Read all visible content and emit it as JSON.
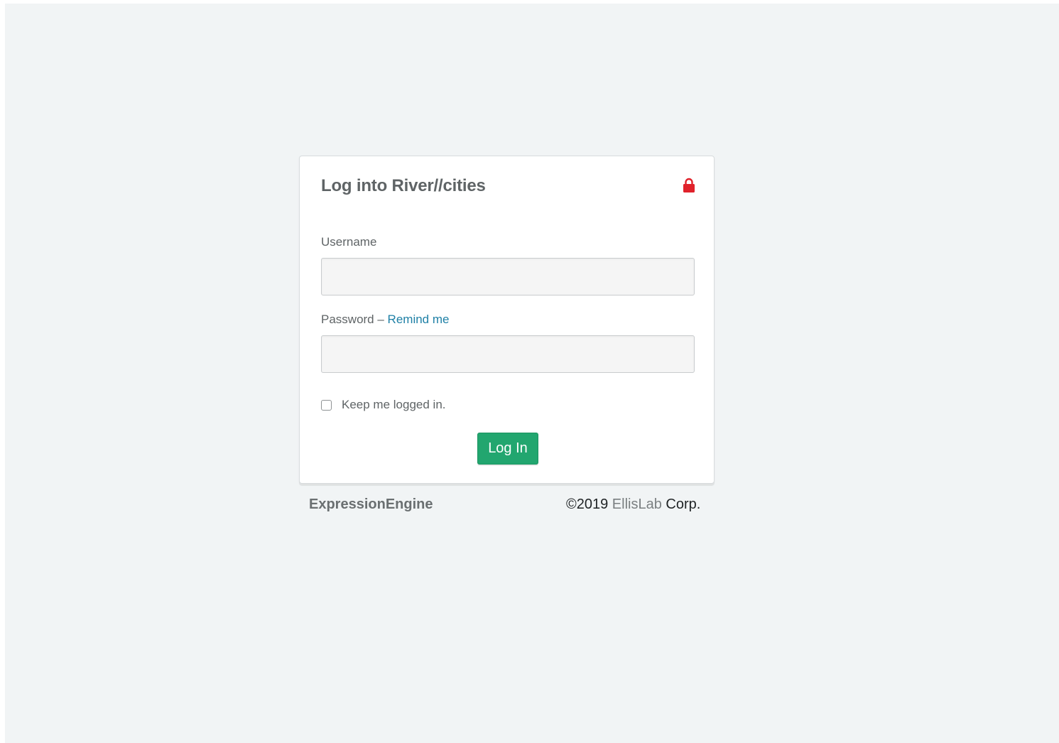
{
  "login": {
    "title": "Log into River//cities",
    "lock_icon": "lock-icon",
    "lock_color": "#e0222b",
    "username_label": "Username",
    "username_value": "",
    "password_label": "Password",
    "password_separator": " – ",
    "remind_link": "Remind me",
    "password_value": "",
    "remember_label": "Keep me logged in.",
    "remember_checked": false,
    "submit_label": "Log In"
  },
  "footer": {
    "brand": "ExpressionEngine",
    "copyright_prefix": "©2019 ",
    "company_link": "EllisLab",
    "copyright_suffix": " Corp."
  },
  "colors": {
    "background": "#f1f4f5",
    "accent_green": "#22a66f",
    "link_blue": "#1f80a6"
  }
}
